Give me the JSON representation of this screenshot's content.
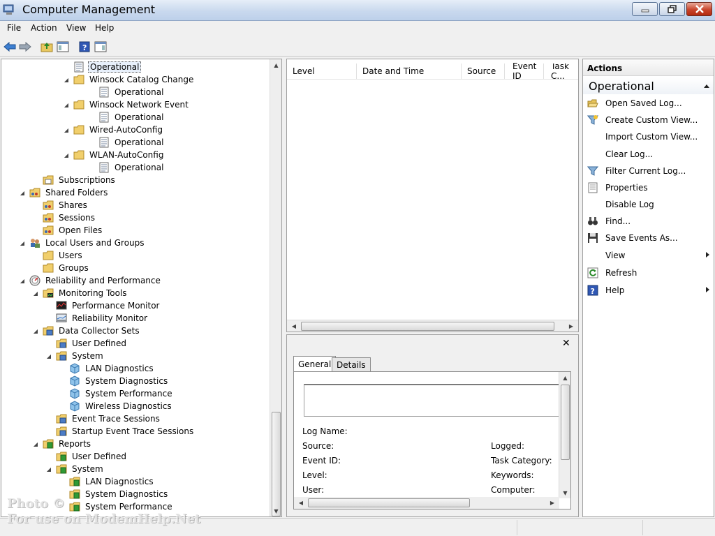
{
  "window": {
    "title": "Computer Management"
  },
  "menu": [
    "File",
    "Action",
    "View",
    "Help"
  ],
  "toolbar": [
    "back-icon",
    "forward-icon",
    "up-folder-icon",
    "show-hide-console-tree-icon",
    "help-icon",
    "show-hide-action-pane-icon"
  ],
  "tree": [
    {
      "label": "Operational",
      "icon": "log-icon",
      "selected": true
    },
    {
      "label": "Winsock Catalog Change",
      "icon": "folder-icon",
      "expander": "expanded"
    },
    {
      "label": "Operational",
      "icon": "log-icon"
    },
    {
      "label": "Winsock Network Event",
      "icon": "folder-icon",
      "expander": "expanded"
    },
    {
      "label": "Operational",
      "icon": "log-icon"
    },
    {
      "label": "Wired-AutoConfig",
      "icon": "folder-icon",
      "expander": "expanded"
    },
    {
      "label": "Operational",
      "icon": "log-icon"
    },
    {
      "label": "WLAN-AutoConfig",
      "icon": "folder-icon",
      "expander": "expanded"
    },
    {
      "label": "Operational",
      "icon": "log-icon"
    },
    {
      "label": "Subscriptions",
      "icon": "subscriptions-icon"
    },
    {
      "label": "Shared Folders",
      "icon": "shared-folder-icon",
      "expander": "expanded"
    },
    {
      "label": "Shares",
      "icon": "shared-folder-icon"
    },
    {
      "label": "Sessions",
      "icon": "shared-folder-icon"
    },
    {
      "label": "Open Files",
      "icon": "shared-folder-icon"
    },
    {
      "label": "Local Users and Groups",
      "icon": "users-groups-icon",
      "expander": "expanded"
    },
    {
      "label": "Users",
      "icon": "folder-icon"
    },
    {
      "label": "Groups",
      "icon": "folder-icon"
    },
    {
      "label": "Reliability and Performance",
      "icon": "gauge-icon",
      "expander": "expanded"
    },
    {
      "label": "Monitoring Tools",
      "icon": "monitoring-folder-icon",
      "expander": "expanded"
    },
    {
      "label": "Performance Monitor",
      "icon": "performance-monitor-icon"
    },
    {
      "label": "Reliability Monitor",
      "icon": "reliability-monitor-icon"
    },
    {
      "label": "Data Collector Sets",
      "icon": "data-collector-folder-icon",
      "expander": "expanded"
    },
    {
      "label": "User Defined",
      "icon": "data-collector-folder-icon"
    },
    {
      "label": "System",
      "icon": "data-collector-folder-icon",
      "expander": "expanded"
    },
    {
      "label": "LAN Diagnostics",
      "icon": "data-collector-set-icon"
    },
    {
      "label": "System Diagnostics",
      "icon": "data-collector-set-icon"
    },
    {
      "label": "System Performance",
      "icon": "data-collector-set-icon"
    },
    {
      "label": "Wireless Diagnostics",
      "icon": "data-collector-set-icon"
    },
    {
      "label": "Event Trace Sessions",
      "icon": "data-collector-folder-icon"
    },
    {
      "label": "Startup Event Trace Sessions",
      "icon": "data-collector-folder-icon"
    },
    {
      "label": "Reports",
      "icon": "reports-folder-icon",
      "expander": "expanded"
    },
    {
      "label": "User Defined",
      "icon": "reports-folder-icon"
    },
    {
      "label": "System",
      "icon": "reports-folder-icon",
      "expander": "expanded"
    },
    {
      "label": "LAN Diagnostics",
      "icon": "reports-folder-icon"
    },
    {
      "label": "System Diagnostics",
      "icon": "reports-folder-icon"
    },
    {
      "label": "System Performance",
      "icon": "reports-folder-icon"
    }
  ],
  "eventlist": {
    "columns": [
      "Level",
      "Date and Time",
      "Source",
      "Event ID",
      "Task C..."
    ]
  },
  "detail": {
    "tabs": [
      "General",
      "Details"
    ],
    "fields_left": [
      "Log Name:",
      "Source:",
      "Event ID:",
      "Level:",
      "User:"
    ],
    "fields_right": [
      "Logged:",
      "Task Category:",
      "Keywords:",
      "Computer:"
    ]
  },
  "actions": {
    "header": "Actions",
    "section": "Operational",
    "items": [
      {
        "label": "Open Saved Log...",
        "icon": "open-folder-icon"
      },
      {
        "label": "Create Custom View...",
        "icon": "funnel-star-icon"
      },
      {
        "label": "Import Custom View...",
        "icon": ""
      },
      {
        "label": "Clear Log...",
        "icon": ""
      },
      {
        "label": "Filter Current Log...",
        "icon": "funnel-icon"
      },
      {
        "label": "Properties",
        "icon": "properties-icon"
      },
      {
        "label": "Disable Log",
        "icon": ""
      },
      {
        "label": "Find...",
        "icon": "binoculars-icon"
      },
      {
        "label": "Save Events As...",
        "icon": "save-icon"
      },
      {
        "label": "View",
        "icon": "",
        "submenu": true
      },
      {
        "label": "Refresh",
        "icon": "refresh-icon"
      },
      {
        "label": "Help",
        "icon": "help-icon",
        "submenu": true
      }
    ]
  },
  "watermark": [
    "Photo ©",
    "For use on ModemHelp.Net"
  ]
}
